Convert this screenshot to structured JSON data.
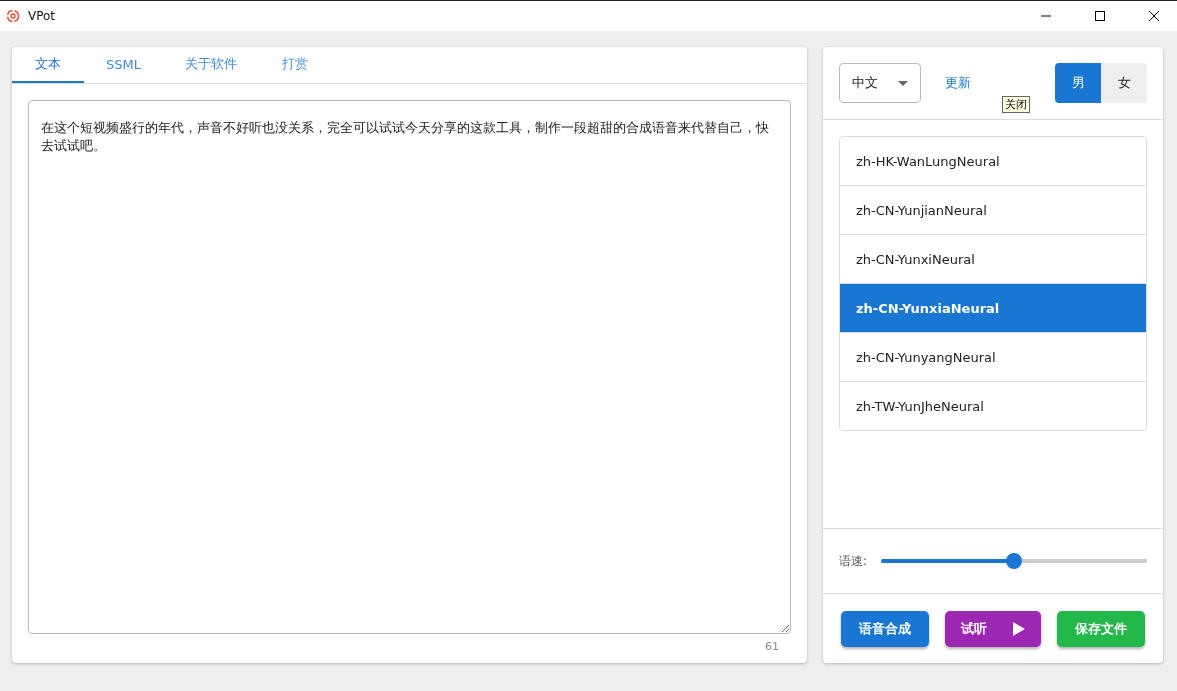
{
  "window": {
    "title": "VPot"
  },
  "tabs": [
    {
      "label": "文本",
      "selected": true
    },
    {
      "label": "SSML",
      "selected": false
    },
    {
      "label": "关于软件",
      "selected": false
    },
    {
      "label": "打赏",
      "selected": false
    }
  ],
  "editor": {
    "value": "在这个短视频盛行的年代，声音不好听也没关系，完全可以试试今天分享的这款工具，制作一段超甜的合成语音来代替自己，快去试试吧。",
    "count": "61"
  },
  "language": {
    "value": "中文"
  },
  "update_link": "更新",
  "tooltip": "关闭",
  "gender": [
    {
      "label": "男",
      "selected": true
    },
    {
      "label": "女",
      "selected": false
    }
  ],
  "voices": [
    {
      "name": "zh-HK-WanLungNeural",
      "selected": false
    },
    {
      "name": "zh-CN-YunjianNeural",
      "selected": false
    },
    {
      "name": "zh-CN-YunxiNeural",
      "selected": false
    },
    {
      "name": "zh-CN-YunxiaNeural",
      "selected": true
    },
    {
      "name": "zh-CN-YunyangNeural",
      "selected": false
    },
    {
      "name": "zh-TW-YunJheNeural",
      "selected": false
    }
  ],
  "speed": {
    "label": "语速:",
    "level": 0.5
  },
  "buttons": [
    {
      "label": "语音合成",
      "kind": "synth"
    },
    {
      "label": "试听",
      "kind": "play"
    },
    {
      "label": "保存文件",
      "kind": "save"
    }
  ]
}
